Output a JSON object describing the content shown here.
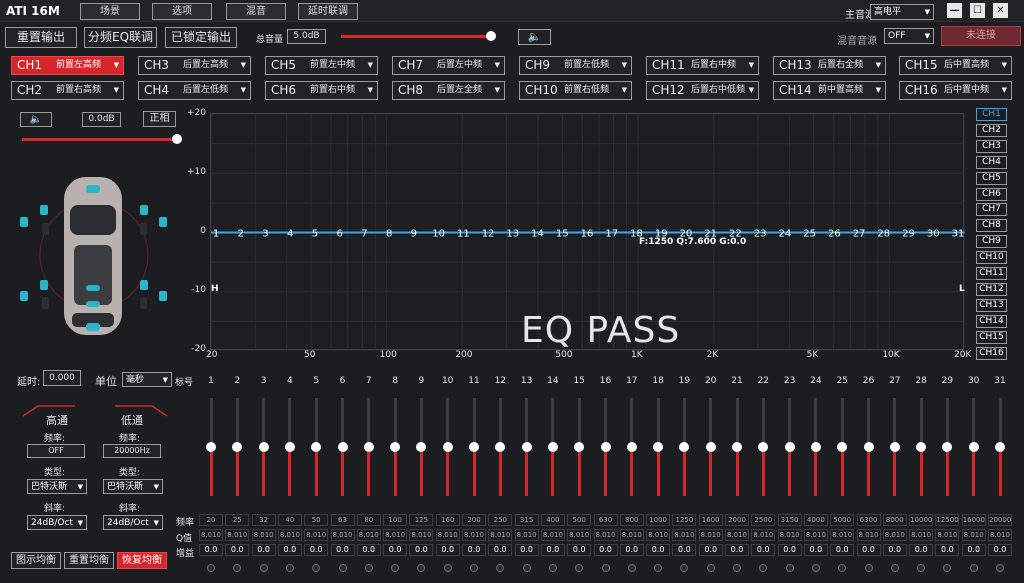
{
  "titlebar": {
    "app_title": "ATI 16M",
    "menu": [
      "场景",
      "选项",
      "混音",
      "延时联调"
    ],
    "main_source_label": "主音源",
    "main_source_value": "高电平",
    "win": {
      "min": "—",
      "max": "☐",
      "close": "✕"
    }
  },
  "toolbar": {
    "reset_output": "重置输出",
    "freq_eq_link": "分频EQ联调",
    "locked_output": "已锁定输出",
    "master_volume_label": "总音量",
    "master_volume_value": "5.0dB",
    "master_volume_fraction": 0.98,
    "mix_source_label": "混音音源",
    "mix_source_value": "OFF",
    "connect_status": "未连接",
    "speaker_icon": "speaker-icon"
  },
  "channels": [
    {
      "id": "CH1",
      "name": "前置左高频",
      "active": true
    },
    {
      "id": "CH2",
      "name": "前置右高频"
    },
    {
      "id": "CH3",
      "name": "后置左高频"
    },
    {
      "id": "CH4",
      "name": "后置左低频"
    },
    {
      "id": "CH5",
      "name": "前置左中频"
    },
    {
      "id": "CH6",
      "name": "前置右中频"
    },
    {
      "id": "CH7",
      "name": "后置左中频"
    },
    {
      "id": "CH8",
      "name": "后置左全频"
    },
    {
      "id": "CH9",
      "name": "前置左低频"
    },
    {
      "id": "CH10",
      "name": "前置右低频"
    },
    {
      "id": "CH11",
      "name": "后置右中频"
    },
    {
      "id": "CH12",
      "name": "后置右中低频"
    },
    {
      "id": "CH13",
      "name": "后置右全频"
    },
    {
      "id": "CH14",
      "name": "前中置高频"
    },
    {
      "id": "CH15",
      "name": "后中置高频"
    },
    {
      "id": "CH16",
      "name": "后中置中频"
    }
  ],
  "channel_panel": {
    "gain_value": "0.0dB",
    "phase_label": "正相",
    "gain_fraction": 1.0
  },
  "graph": {
    "y_ticks": [
      "+20",
      "+10",
      "0",
      "-10",
      "-20"
    ],
    "x_ticks": [
      "20",
      "50",
      "100",
      "200",
      "500",
      "1K",
      "2K",
      "5K",
      "10K",
      "20K"
    ],
    "h_label": "H",
    "l_label": "L",
    "readout": "F:1250 Q:7.600 G:0.0",
    "eq_pass": "EQ PASS",
    "band_points": [
      "1",
      "2",
      "3",
      "4",
      "5",
      "6",
      "7",
      "8",
      "9",
      "10",
      "11",
      "12",
      "13",
      "14",
      "15",
      "16",
      "17",
      "18",
      "19",
      "20",
      "21",
      "22",
      "23",
      "24",
      "25",
      "26",
      "27",
      "28",
      "29",
      "30",
      "31"
    ]
  },
  "right_channels": [
    "CH1",
    "CH2",
    "CH3",
    "CH4",
    "CH5",
    "CH6",
    "CH7",
    "CH8",
    "CH9",
    "CH10",
    "CH11",
    "CH12",
    "CH13",
    "CH14",
    "CH15",
    "CH16"
  ],
  "delay": {
    "label": "延时:",
    "value": "0.000",
    "unit_label": "单位",
    "unit_value": "毫秒",
    "band_label": "标号"
  },
  "crossover": {
    "hp": {
      "title": "高通",
      "freq_label": "频率:",
      "freq": "OFF",
      "type_label": "类型:",
      "type": "巴特沃斯",
      "slope_label": "斜率:",
      "slope": "24dB/Oct"
    },
    "lp": {
      "title": "低通",
      "freq_label": "频率:",
      "freq": "20000Hz",
      "type_label": "类型:",
      "type": "巴特沃斯",
      "slope_label": "斜率:",
      "slope": "24dB/Oct"
    }
  },
  "bottom_buttons": {
    "graphic_eq": "图示均衡",
    "reset_eq": "重置均衡",
    "restore_eq": "恢复均衡"
  },
  "eq_bands": {
    "numbers": [
      "1",
      "2",
      "3",
      "4",
      "5",
      "6",
      "7",
      "8",
      "9",
      "10",
      "11",
      "12",
      "13",
      "14",
      "15",
      "16",
      "17",
      "18",
      "19",
      "20",
      "21",
      "22",
      "23",
      "24",
      "25",
      "26",
      "27",
      "28",
      "29",
      "30",
      "31"
    ],
    "row_labels": {
      "freq": "频率",
      "q": "Q值",
      "gain": "增益"
    },
    "freqs": [
      "20",
      "25",
      "32",
      "40",
      "50",
      "63",
      "80",
      "100",
      "125",
      "160",
      "200",
      "250",
      "315",
      "400",
      "500",
      "630",
      "800",
      "1000",
      "1250",
      "1600",
      "2000",
      "2500",
      "3150",
      "4000",
      "5000",
      "6300",
      "8000",
      "10000",
      "12500",
      "16000",
      "20000"
    ],
    "q": "8.010",
    "gain": "0.0",
    "level_fraction": 0.5
  }
}
